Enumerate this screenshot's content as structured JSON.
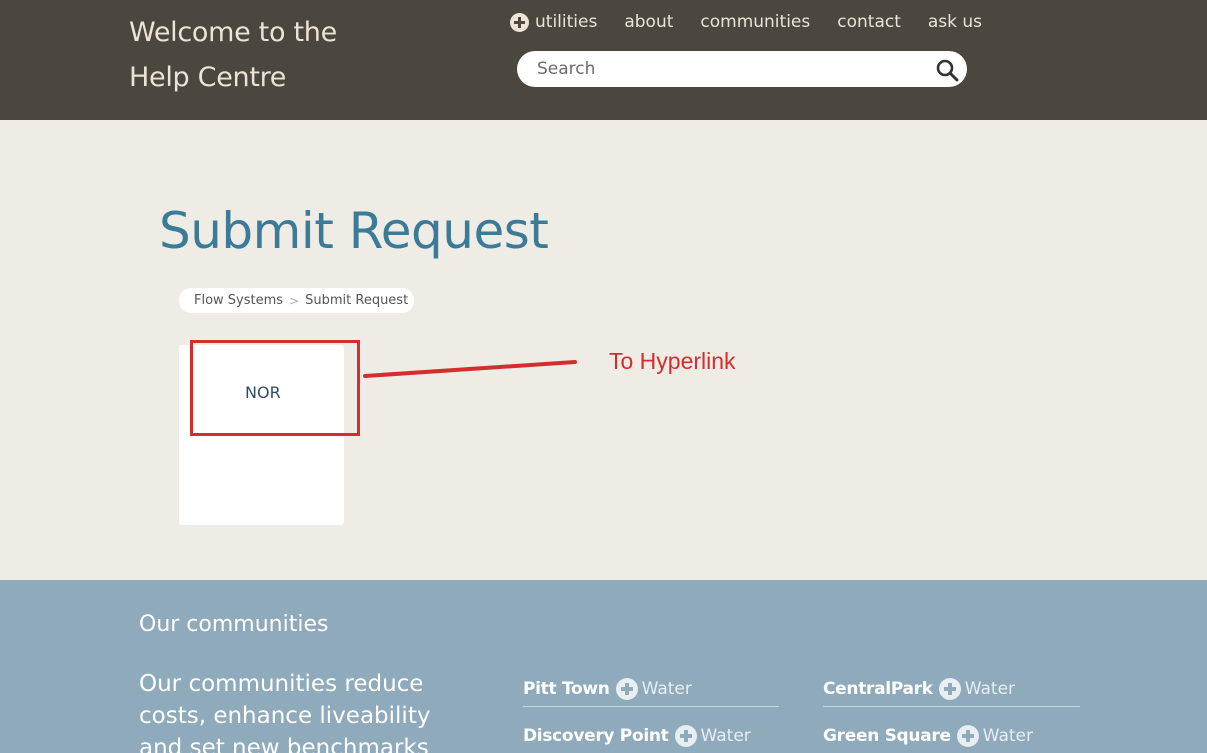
{
  "header": {
    "title_line1": "Welcome to the",
    "title_line2": "Help Centre",
    "nav": [
      {
        "label": "utilities"
      },
      {
        "label": "about"
      },
      {
        "label": "communities"
      },
      {
        "label": "contact"
      },
      {
        "label": "ask us"
      }
    ],
    "search": {
      "placeholder": "Search"
    }
  },
  "main": {
    "page_title": "Submit Request",
    "breadcrumb": [
      "Flow Systems",
      "Submit Request"
    ],
    "card_label": "NOR",
    "annotation_text": "To Hyperlink"
  },
  "footer": {
    "heading": "Our communities",
    "text": "Our communities reduce costs, enhance liveability and set new benchmarks",
    "communities": [
      {
        "name": "Pitt Town",
        "suffix": "Water"
      },
      {
        "name": "CentralPark",
        "suffix": "Water"
      },
      {
        "name": "Discovery Point",
        "suffix": "Water"
      },
      {
        "name": "Green Square",
        "suffix": "Water"
      }
    ]
  },
  "colors": {
    "header_bg": "#4b463e",
    "title_blue": "#3b7b98",
    "annotation_red": "#d42d2e",
    "footer_bg": "#8eaabb"
  }
}
